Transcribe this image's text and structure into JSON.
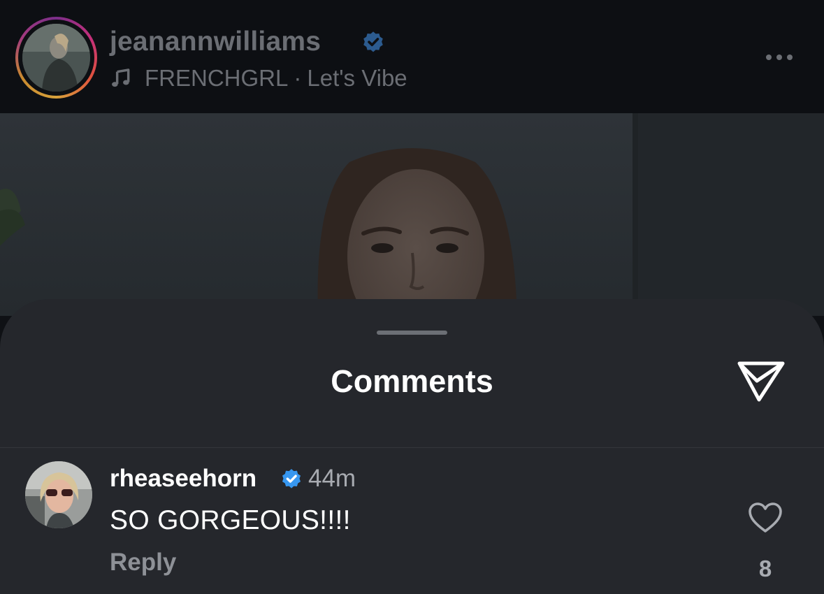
{
  "post": {
    "username": "jeanannwilliams",
    "verified": true,
    "music": {
      "artist": "FRENCHGRL",
      "separator": "·",
      "track": "Let's Vibe"
    },
    "more_icon": "more-horizontal-icon"
  },
  "comments_sheet": {
    "title": "Comments",
    "share_icon": "send-icon",
    "comments": [
      {
        "username": "rheaseehorn",
        "verified": true,
        "time": "44m",
        "text": "SO GORGEOUS!!!!",
        "reply_label": "Reply",
        "like_icon": "heart-icon",
        "like_count": "8"
      }
    ]
  },
  "colors": {
    "verified_badge": "#3797f0",
    "sheet_background": "#25272c",
    "header_background": "#0d0f13"
  }
}
